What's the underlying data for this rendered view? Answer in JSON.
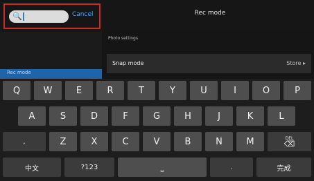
{
  "search": {
    "placeholder": "",
    "cancel_label": "Cancel"
  },
  "header": {
    "title": "Rec mode"
  },
  "left_panel": {
    "selected_label": "Rec mode"
  },
  "settings": {
    "section_title": "Photo settings",
    "rows": [
      {
        "label": "Snap mode",
        "value": "Store ▸"
      }
    ]
  },
  "keyboard": {
    "row1": [
      "Q",
      "W",
      "E",
      "R",
      "T",
      "Y",
      "U",
      "I",
      "O",
      "P"
    ],
    "row2": [
      "A",
      "S",
      "D",
      "F",
      "G",
      "H",
      "J",
      "K",
      "L"
    ],
    "row3": [
      ",",
      "Z",
      "X",
      "C",
      "V",
      "B",
      "N",
      "M"
    ],
    "del": {
      "small": "DEL",
      "glyph": "⌫"
    },
    "bottom": {
      "lang": "中文",
      "numbers": "?123",
      "space": "⎵",
      "period": ".",
      "done": "完成"
    }
  },
  "colors": {
    "accent_red": "#d1262a",
    "link_blue": "#4ea4f0",
    "key_bg": "#4e4e4e"
  }
}
